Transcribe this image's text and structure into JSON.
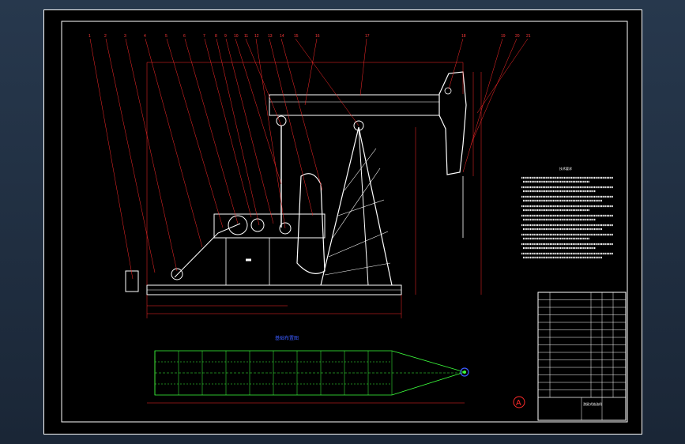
{
  "drawing": {
    "view_title": "",
    "plan_title": "基础布置图",
    "section_label": "A",
    "leader_numbers": [
      "1",
      "2",
      "3",
      "4",
      "5",
      "6",
      "7",
      "8",
      "9",
      "10",
      "11",
      "12",
      "13",
      "14",
      "15",
      "16",
      "17",
      "18",
      "19",
      "20",
      "21"
    ],
    "dims": {
      "overall_height": "",
      "overall_length": "",
      "base_length": ""
    },
    "notes_title": "技术要求",
    "notes": [
      "",
      "",
      "",
      "",
      "",
      "",
      "",
      "",
      ""
    ]
  },
  "title_block": {
    "drawing_name": "游梁式抽油机",
    "rows": 14
  },
  "colors": {
    "frame": "#ffffff",
    "dimension": "#ff2a2a",
    "plan": "#3cff3c",
    "text": "#ffffff",
    "title": "#3b5bff"
  }
}
